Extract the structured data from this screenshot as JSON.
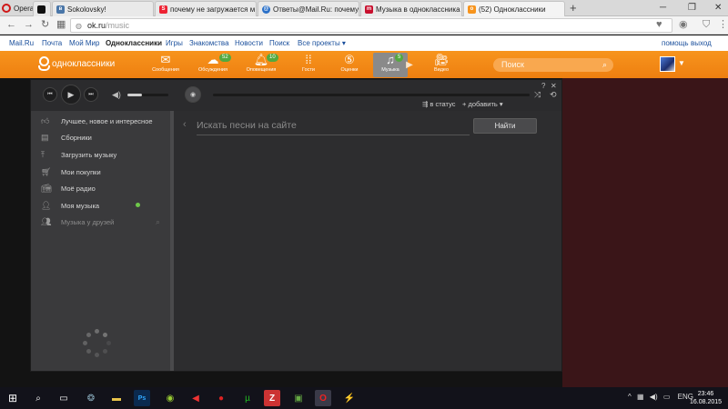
{
  "browser": {
    "menu_label": "Opera",
    "tabs": [
      {
        "title": "",
        "favicon": "black-square-icon"
      },
      {
        "title": "Sokolovsky!",
        "favicon": "vk-icon"
      },
      {
        "title": "почему не загружается м",
        "favicon": "search-icon"
      },
      {
        "title": "Ответы@Mail.Ru: почему",
        "favicon": "answers-icon"
      },
      {
        "title": "Музыка в одноклассника",
        "favicon": "mailru-music-icon"
      },
      {
        "title": "(52) Одноклассники",
        "favicon": "ok-icon"
      }
    ],
    "url_domain": "ok.ru",
    "url_path": "/music"
  },
  "mailru_bar": {
    "links": [
      "Mail.Ru",
      "Почта",
      "Мой Мир",
      "Одноклассники",
      "Игры",
      "Знакомства",
      "Новости",
      "Поиск",
      "Все проекты ▾"
    ],
    "right_links": [
      "помощь",
      "выход"
    ]
  },
  "ok_header": {
    "logo_text": "одноклассники",
    "nav": [
      {
        "label": "Сообщения",
        "icon": "envelope-icon",
        "badge": ""
      },
      {
        "label": "Обсуждения",
        "icon": "discussions-icon",
        "badge": "52"
      },
      {
        "label": "Оповещения",
        "icon": "bell-icon",
        "badge": "10"
      },
      {
        "label": "Гости",
        "icon": "footprints-icon",
        "badge": ""
      },
      {
        "label": "Оценки",
        "icon": "ratings-icon",
        "badge": ""
      },
      {
        "label": "Музыка",
        "icon": "music-note-icon",
        "badge": "5"
      },
      {
        "label": "Видео",
        "icon": "video-camera-icon",
        "badge": ""
      }
    ],
    "search_placeholder": "Поиск"
  },
  "player": {
    "volume_level": 0.35,
    "progress_level": 0,
    "to_status_label": "в статус",
    "add_label": "+ добавить ▾",
    "sidebar": [
      {
        "label": "Лучшее, новое и интересное",
        "icon": "thumbs-up-icon"
      },
      {
        "label": "Сборники",
        "icon": "collections-icon"
      },
      {
        "label": "Загрузить музыку",
        "icon": "upload-icon"
      },
      {
        "label": "Мои покупки",
        "icon": "cart-icon"
      },
      {
        "label": "Моё радио",
        "icon": "radio-icon"
      },
      {
        "label": "Моя музыка",
        "icon": "add-user-icon"
      },
      {
        "label": "Музыка у друзей",
        "icon": "friends-icon"
      }
    ],
    "search_placeholder": "Искать песни на сайте",
    "find_button": "Найти"
  },
  "taskbar": {
    "lang": "ENG",
    "time": "23:46",
    "date": "16.08.2015"
  },
  "colors": {
    "ok_orange": "#f7941d",
    "badge_green": "#53a93f",
    "player_bg": "#2b2b2d",
    "sidebar_bg": "#3a3a3c"
  }
}
